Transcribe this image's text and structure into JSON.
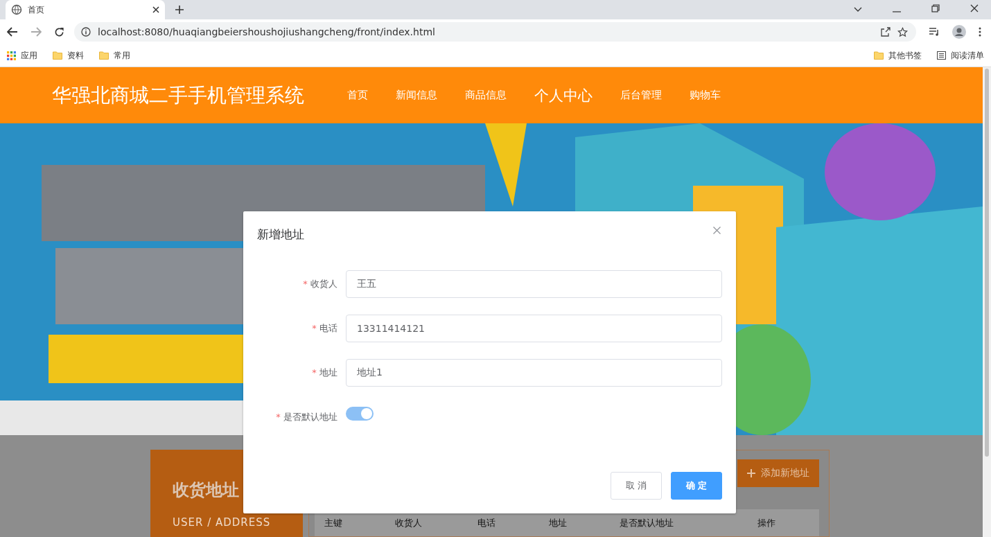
{
  "browser": {
    "tab": {
      "title": "首页"
    },
    "url": "localhost:8080/huaqiangbeiershoushojiushangcheng/front/index.html",
    "bookmarks": [
      {
        "label": "应用",
        "kind": "apps"
      },
      {
        "label": "资料",
        "kind": "folder"
      },
      {
        "label": "常用",
        "kind": "folder"
      }
    ],
    "bookmarks_right": [
      {
        "label": "其他书签",
        "kind": "folder"
      },
      {
        "label": "阅读清单",
        "kind": "list"
      }
    ]
  },
  "site": {
    "title": "华强北商城二手手机管理系统",
    "nav": [
      {
        "label": "首页",
        "selected": false
      },
      {
        "label": "新闻信息",
        "selected": false
      },
      {
        "label": "商品信息",
        "selected": false
      },
      {
        "label": "个人中心",
        "selected": true
      },
      {
        "label": "后台管理",
        "selected": false
      },
      {
        "label": "购物车",
        "selected": false
      }
    ]
  },
  "sidebar": {
    "title": "收货地址",
    "subtitle": "USER / ADDRESS"
  },
  "add_button": {
    "label": "添加新地址"
  },
  "table": {
    "columns": [
      "主键",
      "收货人",
      "电话",
      "地址",
      "是否默认地址",
      "操作"
    ]
  },
  "dialog": {
    "title": "新增地址",
    "fields": [
      {
        "label": "收货人",
        "required_mark": "*",
        "kind": "text",
        "value": "王五"
      },
      {
        "label": "电话",
        "required_mark": "*",
        "kind": "text",
        "value": "13311414121"
      },
      {
        "label": "地址",
        "required_mark": "*",
        "kind": "text",
        "value": "地址1"
      },
      {
        "label": "是否默认地址",
        "required_mark": "*",
        "kind": "switch",
        "on": true
      }
    ],
    "buttons": [
      {
        "label": "取 消",
        "kind": "default"
      },
      {
        "label": "确 定",
        "kind": "primary"
      }
    ]
  }
}
